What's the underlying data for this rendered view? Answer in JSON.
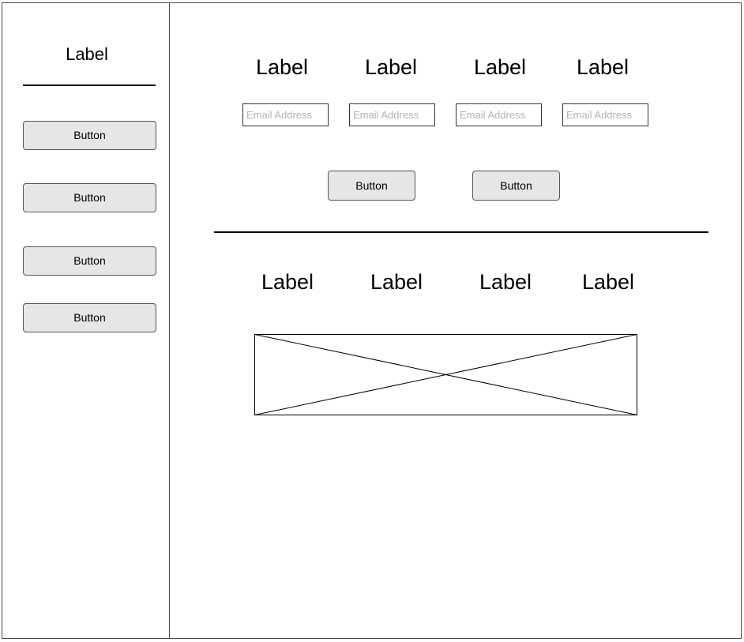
{
  "sidebar": {
    "title": "Label",
    "buttons": [
      {
        "label": "Button"
      },
      {
        "label": "Button"
      },
      {
        "label": "Button"
      },
      {
        "label": "Button"
      }
    ]
  },
  "main": {
    "top_labels": [
      "Label",
      "Label",
      "Label",
      "Label"
    ],
    "email_fields": [
      {
        "placeholder": "Email Address",
        "value": ""
      },
      {
        "placeholder": "Email Address",
        "value": ""
      },
      {
        "placeholder": "Email Address",
        "value": ""
      },
      {
        "placeholder": "Email Address",
        "value": ""
      }
    ],
    "buttons": [
      {
        "label": "Button"
      },
      {
        "label": "Button"
      }
    ],
    "bottom_labels": [
      "Label",
      "Label",
      "Label",
      "Label"
    ],
    "image_placeholder_icon": "image-placeholder-x-icon"
  },
  "colors": {
    "button_fill": "#e6e6e6",
    "border": "#4a4a4a",
    "placeholder_text": "#b3b3b3"
  }
}
